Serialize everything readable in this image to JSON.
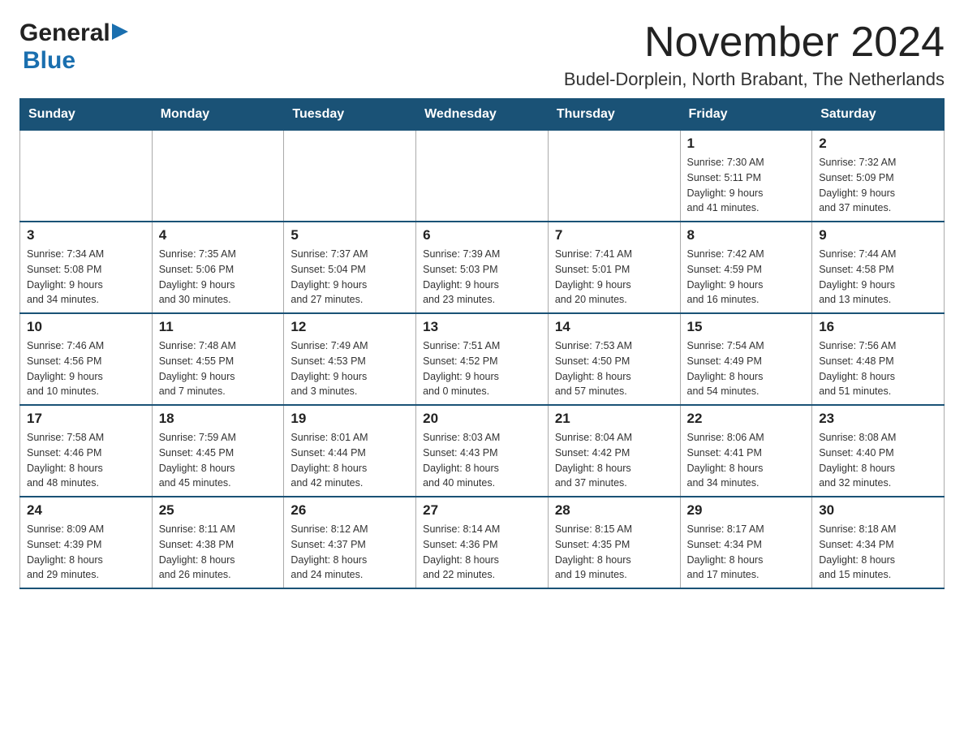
{
  "logo": {
    "general": "General",
    "blue": "Blue",
    "arrow": "▶"
  },
  "title": "November 2024",
  "subtitle": "Budel-Dorplein, North Brabant, The Netherlands",
  "weekdays": [
    "Sunday",
    "Monday",
    "Tuesday",
    "Wednesday",
    "Thursday",
    "Friday",
    "Saturday"
  ],
  "weeks": [
    {
      "days": [
        {
          "number": "",
          "info": ""
        },
        {
          "number": "",
          "info": ""
        },
        {
          "number": "",
          "info": ""
        },
        {
          "number": "",
          "info": ""
        },
        {
          "number": "",
          "info": ""
        },
        {
          "number": "1",
          "info": "Sunrise: 7:30 AM\nSunset: 5:11 PM\nDaylight: 9 hours\nand 41 minutes."
        },
        {
          "number": "2",
          "info": "Sunrise: 7:32 AM\nSunset: 5:09 PM\nDaylight: 9 hours\nand 37 minutes."
        }
      ]
    },
    {
      "days": [
        {
          "number": "3",
          "info": "Sunrise: 7:34 AM\nSunset: 5:08 PM\nDaylight: 9 hours\nand 34 minutes."
        },
        {
          "number": "4",
          "info": "Sunrise: 7:35 AM\nSunset: 5:06 PM\nDaylight: 9 hours\nand 30 minutes."
        },
        {
          "number": "5",
          "info": "Sunrise: 7:37 AM\nSunset: 5:04 PM\nDaylight: 9 hours\nand 27 minutes."
        },
        {
          "number": "6",
          "info": "Sunrise: 7:39 AM\nSunset: 5:03 PM\nDaylight: 9 hours\nand 23 minutes."
        },
        {
          "number": "7",
          "info": "Sunrise: 7:41 AM\nSunset: 5:01 PM\nDaylight: 9 hours\nand 20 minutes."
        },
        {
          "number": "8",
          "info": "Sunrise: 7:42 AM\nSunset: 4:59 PM\nDaylight: 9 hours\nand 16 minutes."
        },
        {
          "number": "9",
          "info": "Sunrise: 7:44 AM\nSunset: 4:58 PM\nDaylight: 9 hours\nand 13 minutes."
        }
      ]
    },
    {
      "days": [
        {
          "number": "10",
          "info": "Sunrise: 7:46 AM\nSunset: 4:56 PM\nDaylight: 9 hours\nand 10 minutes."
        },
        {
          "number": "11",
          "info": "Sunrise: 7:48 AM\nSunset: 4:55 PM\nDaylight: 9 hours\nand 7 minutes."
        },
        {
          "number": "12",
          "info": "Sunrise: 7:49 AM\nSunset: 4:53 PM\nDaylight: 9 hours\nand 3 minutes."
        },
        {
          "number": "13",
          "info": "Sunrise: 7:51 AM\nSunset: 4:52 PM\nDaylight: 9 hours\nand 0 minutes."
        },
        {
          "number": "14",
          "info": "Sunrise: 7:53 AM\nSunset: 4:50 PM\nDaylight: 8 hours\nand 57 minutes."
        },
        {
          "number": "15",
          "info": "Sunrise: 7:54 AM\nSunset: 4:49 PM\nDaylight: 8 hours\nand 54 minutes."
        },
        {
          "number": "16",
          "info": "Sunrise: 7:56 AM\nSunset: 4:48 PM\nDaylight: 8 hours\nand 51 minutes."
        }
      ]
    },
    {
      "days": [
        {
          "number": "17",
          "info": "Sunrise: 7:58 AM\nSunset: 4:46 PM\nDaylight: 8 hours\nand 48 minutes."
        },
        {
          "number": "18",
          "info": "Sunrise: 7:59 AM\nSunset: 4:45 PM\nDaylight: 8 hours\nand 45 minutes."
        },
        {
          "number": "19",
          "info": "Sunrise: 8:01 AM\nSunset: 4:44 PM\nDaylight: 8 hours\nand 42 minutes."
        },
        {
          "number": "20",
          "info": "Sunrise: 8:03 AM\nSunset: 4:43 PM\nDaylight: 8 hours\nand 40 minutes."
        },
        {
          "number": "21",
          "info": "Sunrise: 8:04 AM\nSunset: 4:42 PM\nDaylight: 8 hours\nand 37 minutes."
        },
        {
          "number": "22",
          "info": "Sunrise: 8:06 AM\nSunset: 4:41 PM\nDaylight: 8 hours\nand 34 minutes."
        },
        {
          "number": "23",
          "info": "Sunrise: 8:08 AM\nSunset: 4:40 PM\nDaylight: 8 hours\nand 32 minutes."
        }
      ]
    },
    {
      "days": [
        {
          "number": "24",
          "info": "Sunrise: 8:09 AM\nSunset: 4:39 PM\nDaylight: 8 hours\nand 29 minutes."
        },
        {
          "number": "25",
          "info": "Sunrise: 8:11 AM\nSunset: 4:38 PM\nDaylight: 8 hours\nand 26 minutes."
        },
        {
          "number": "26",
          "info": "Sunrise: 8:12 AM\nSunset: 4:37 PM\nDaylight: 8 hours\nand 24 minutes."
        },
        {
          "number": "27",
          "info": "Sunrise: 8:14 AM\nSunset: 4:36 PM\nDaylight: 8 hours\nand 22 minutes."
        },
        {
          "number": "28",
          "info": "Sunrise: 8:15 AM\nSunset: 4:35 PM\nDaylight: 8 hours\nand 19 minutes."
        },
        {
          "number": "29",
          "info": "Sunrise: 8:17 AM\nSunset: 4:34 PM\nDaylight: 8 hours\nand 17 minutes."
        },
        {
          "number": "30",
          "info": "Sunrise: 8:18 AM\nSunset: 4:34 PM\nDaylight: 8 hours\nand 15 minutes."
        }
      ]
    }
  ]
}
